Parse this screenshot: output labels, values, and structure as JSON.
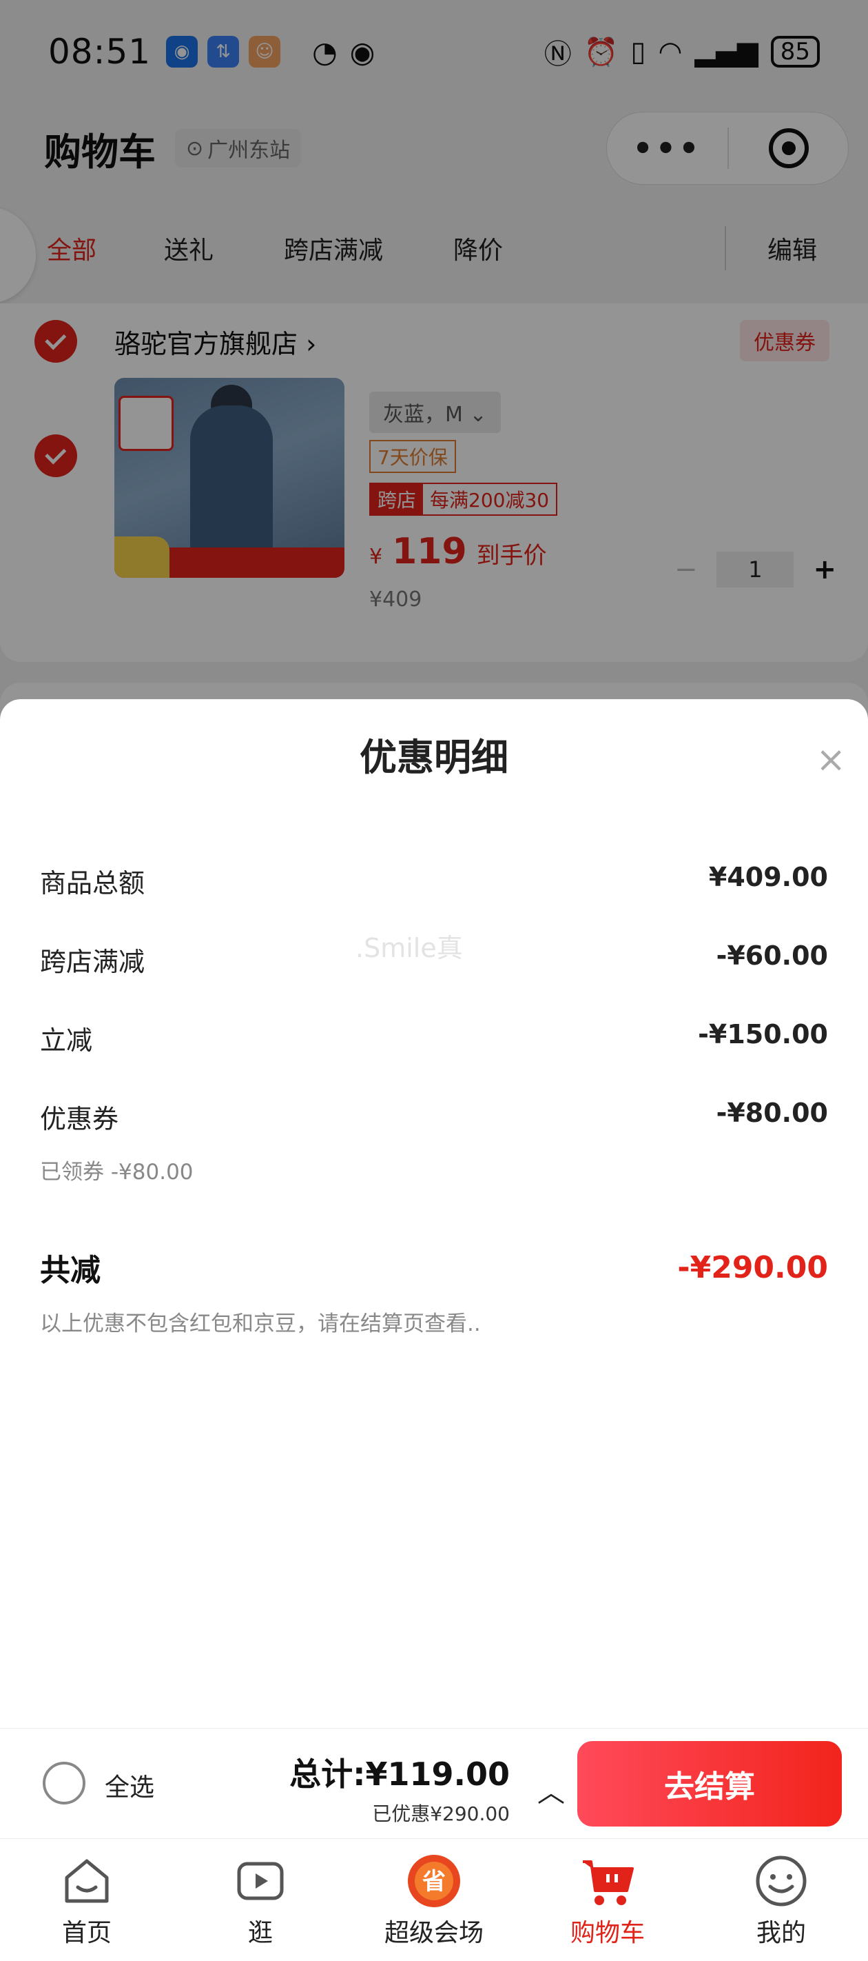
{
  "status_bar": {
    "time": "08:51",
    "battery": "85"
  },
  "header": {
    "title": "购物车",
    "location": "广州东站",
    "more_label": "•••"
  },
  "tabs": [
    {
      "label": "全部",
      "active": true
    },
    {
      "label": "送礼",
      "active": false
    },
    {
      "label": "跨店满减",
      "active": false
    },
    {
      "label": "降价",
      "active": false
    }
  ],
  "edit_label": "编辑",
  "shop": {
    "name": "骆驼官方旗舰店",
    "arrow": "›",
    "coupon_label": "优惠券",
    "product": {
      "sku": "灰蓝，M",
      "guarantee": "7天价保",
      "promo_tag": "跨店",
      "promo_text": "每满200减30",
      "price_symbol": "¥",
      "price": "119",
      "price_label": "到手价",
      "original_price": "¥409",
      "quantity": "1",
      "minus": "−",
      "plus": "+"
    }
  },
  "sheet": {
    "title": "优惠明细",
    "close": "×",
    "watermark": ".Smile真",
    "rows": [
      {
        "label": "商品总额",
        "value": "¥409.00"
      },
      {
        "label": "跨店满减",
        "value": "-¥60.00"
      },
      {
        "label": "立减",
        "value": "-¥150.00"
      },
      {
        "label": "优惠券",
        "value": "-¥80.00"
      }
    ],
    "coupon_sub": "已领券 -¥80.00",
    "total_label": "共减",
    "total_value": "-¥290.00",
    "note": "以上优惠不包含红包和京豆，请在结算页查看.."
  },
  "checkout": {
    "select_all": "全选",
    "total": "总计:¥119.00",
    "discount": "已优惠¥290.00",
    "caret": "︿",
    "pay_button": "去结算"
  },
  "tabbar": [
    {
      "label": "首页",
      "icon": "home-icon",
      "active": false
    },
    {
      "label": "逛",
      "icon": "video-icon",
      "active": false
    },
    {
      "label": "超级会场",
      "icon": "venue-icon",
      "active": false
    },
    {
      "label": "购物车",
      "icon": "cart-icon",
      "active": true
    },
    {
      "label": "我的",
      "icon": "profile-icon",
      "active": false
    }
  ],
  "colors": {
    "accent": "#e2231a",
    "overlay": "rgba(0,0,0,0.42)"
  }
}
